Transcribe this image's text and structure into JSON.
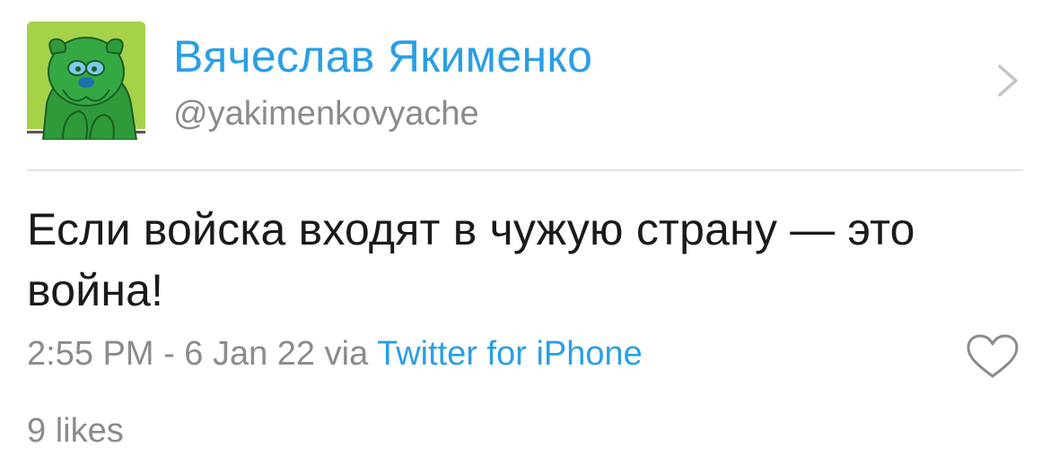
{
  "author": {
    "display_name": "Вячеслав Якименко",
    "handle": "@yakimenkovyache",
    "avatar_icon": "green-bulldog-avatar-icon"
  },
  "tweet": {
    "text": "Если войска входят в чужую страну — это война!",
    "timestamp": "2:55 PM - 6 Jan 22",
    "via_label": "via",
    "source": "Twitter for iPhone",
    "likes": "9 likes"
  },
  "icons": {
    "chevron": "chevron-right-icon",
    "like": "heart-icon"
  },
  "colors": {
    "link": "#2a9fe6",
    "muted": "#8a8a8f",
    "text": "#1a1a1a",
    "avatar_bg": "#a6d24a",
    "avatar_dog": "#2e9a3a"
  }
}
